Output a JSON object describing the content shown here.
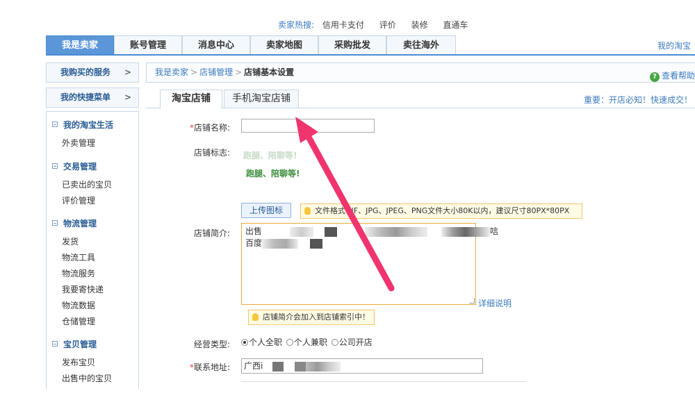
{
  "hot_search": {
    "label": "卖家热搜:",
    "links": [
      "信用卡支付",
      "评价",
      "装修",
      "直通车"
    ]
  },
  "top_nav": {
    "tabs": [
      "我是卖家",
      "账号管理",
      "消息中心",
      "卖家地图",
      "采购批发",
      "卖往海外"
    ],
    "right_link": "我的淘宝"
  },
  "side_boxes": {
    "purchased_services": "我购买的服务",
    "quick_menu": "我的快捷菜单",
    "chevron": ">"
  },
  "sidebar": {
    "groups": [
      {
        "title": "我的淘宝生活",
        "items": [
          "外卖管理"
        ]
      },
      {
        "title": "交易管理",
        "items": [
          "已卖出的宝贝",
          "评价管理"
        ]
      },
      {
        "title": "物流管理",
        "items": [
          "发货",
          "物流工具",
          "物流服务",
          "我要寄快递",
          "物流数据",
          "仓储管理"
        ]
      },
      {
        "title": "宝贝管理",
        "items": [
          "发布宝贝",
          "出售中的宝贝"
        ]
      }
    ]
  },
  "breadcrumb": {
    "items": [
      "我是卖家",
      "店铺管理"
    ],
    "current": "店铺基本设置",
    "separator": ">",
    "help": "查看帮助",
    "help_icon": "?"
  },
  "sub_tabs": {
    "tabs": [
      "淘宝店铺",
      "手机淘宝店铺"
    ],
    "notice": "重要：开店必知！快速成交！"
  },
  "form": {
    "required_mark": "*",
    "shop_name_label": "店铺名称:",
    "shop_name_value": "",
    "shop_logo_label": "店铺标志:",
    "logo_text_line1": "跑腿、陪聊等!",
    "logo_text_line2": "跑腿、陪聊等!",
    "upload_button": "上传图标",
    "logo_tip": "文件格式GIF、JPG、JPEG、PNG文件大小80K以内，建议尺寸80PX*80PX",
    "intro_label": "店铺简介:",
    "intro_line1_start": "出售",
    "intro_line1_end": "唁",
    "intro_line2_start": "百度",
    "detail_link": "详细说明",
    "intro_tip": "店铺简介会加入到店铺索引中！",
    "business_type_label": "经营类型:",
    "business_options": [
      "个人全职",
      "个人兼职",
      "公司开店"
    ],
    "business_selected": 0,
    "address_label": "联系地址:",
    "address_value_start": "广西i"
  },
  "colors": {
    "accent_blue": "#5b97d8",
    "link_blue": "#3b7bbf",
    "annotation_arrow": "#f0346e",
    "required_red": "#e4393c"
  }
}
